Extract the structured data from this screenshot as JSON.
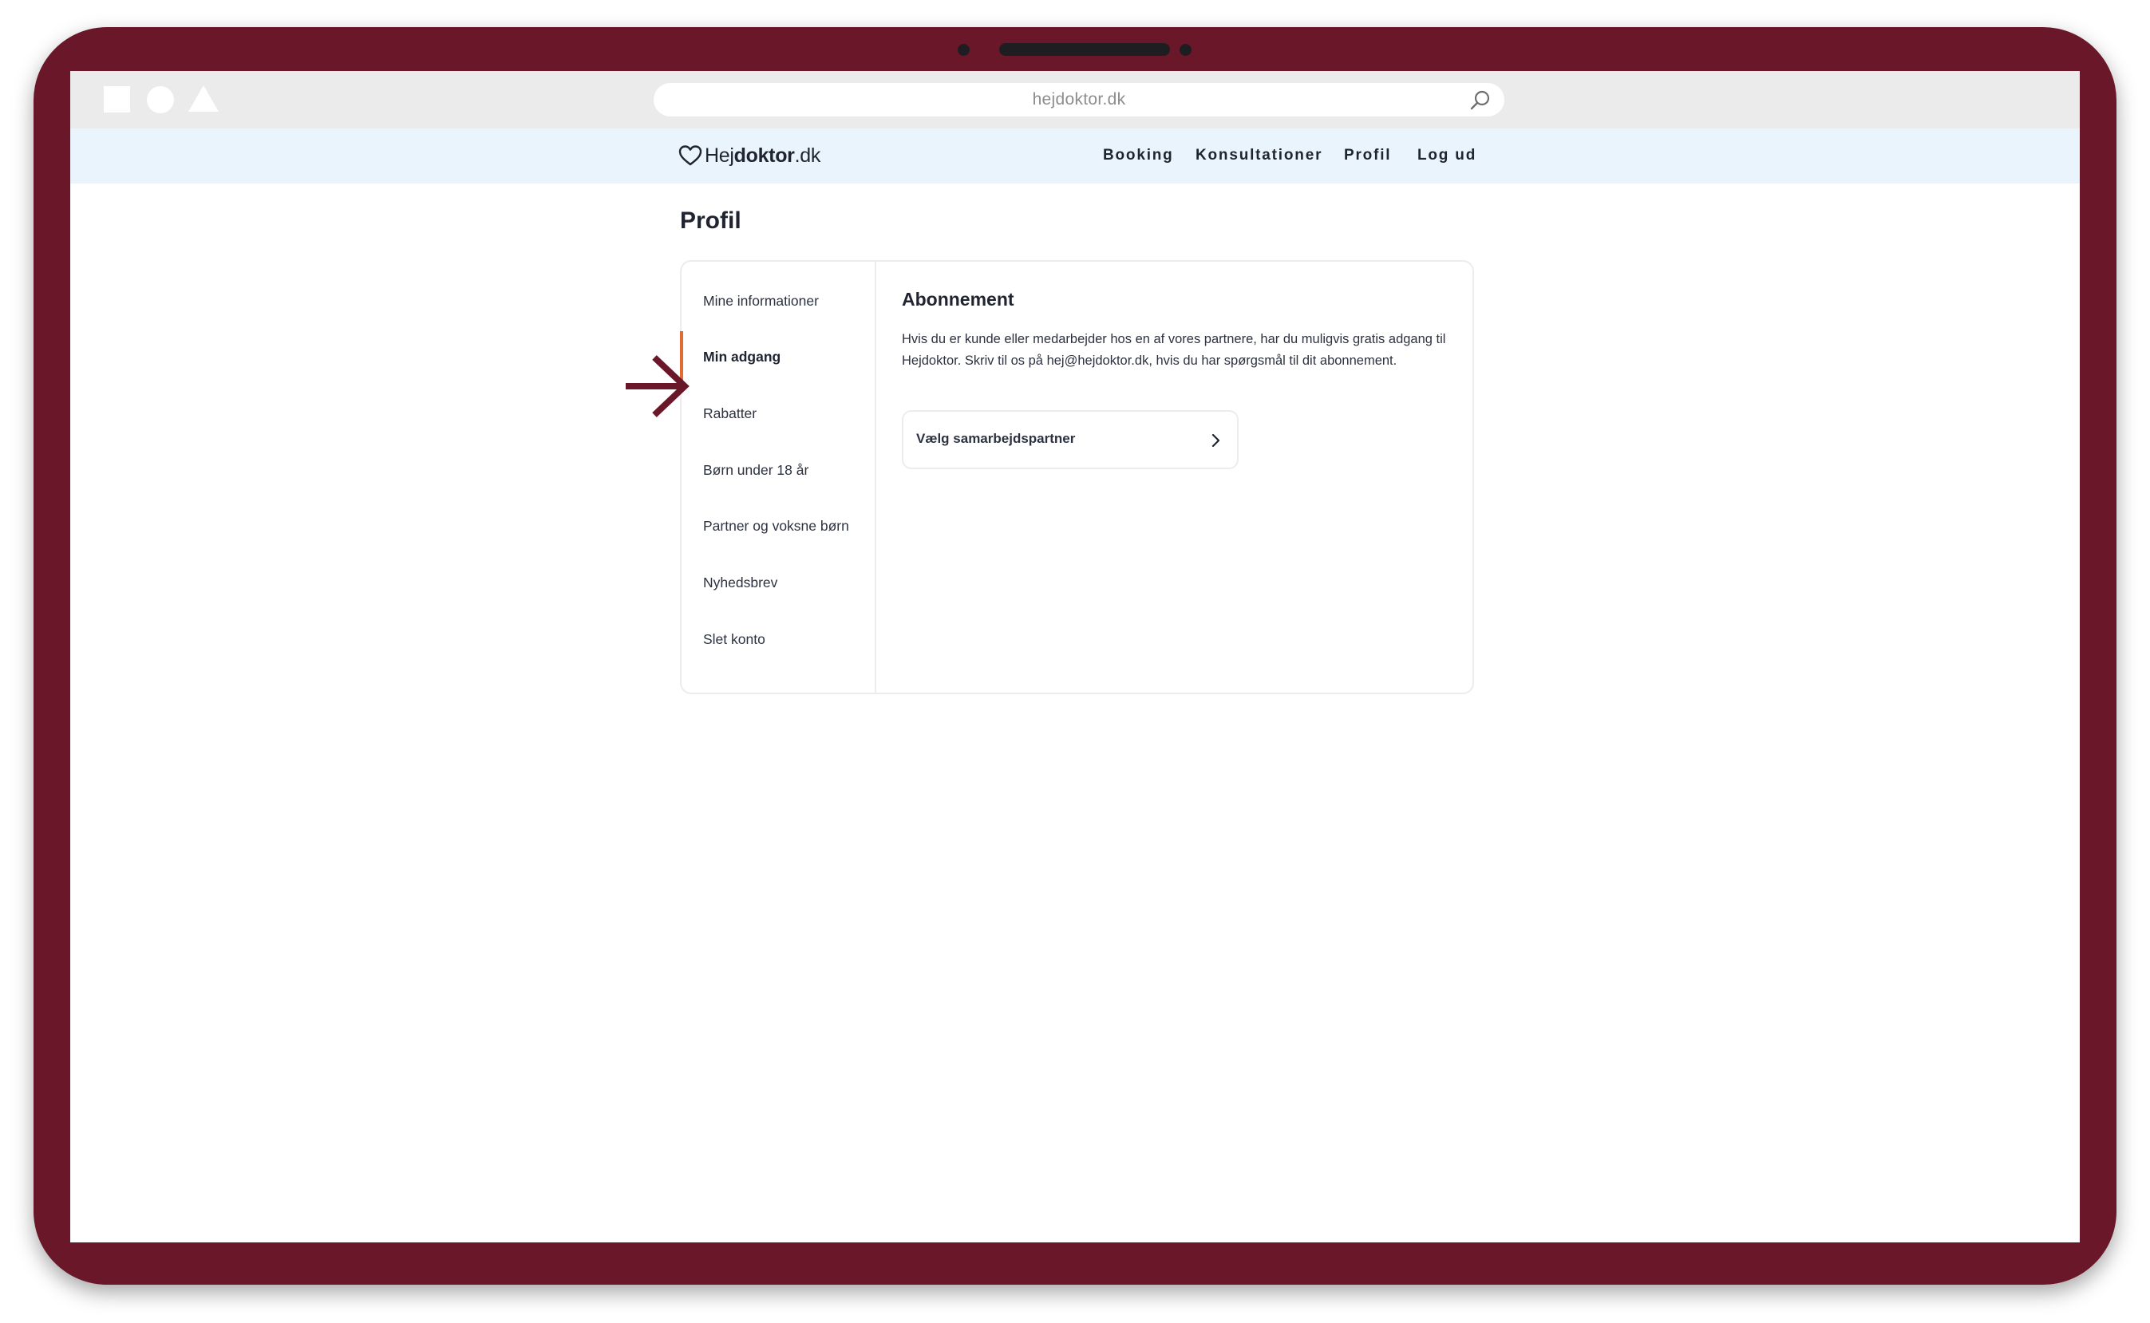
{
  "browser": {
    "url": "hejdoktor.dk"
  },
  "header": {
    "logo": {
      "light": "Hej",
      "bold": "doktor",
      "suffix": ".dk"
    },
    "nav": [
      "Booking",
      "Konsultationer",
      "Profil",
      "Log ud"
    ]
  },
  "page": {
    "title": "Profil"
  },
  "sidebar": {
    "active_index": 1,
    "items": [
      {
        "label": "Mine informationer"
      },
      {
        "label": "Min adgang"
      },
      {
        "label": "Rabatter"
      },
      {
        "label": "Børn under 18 år"
      },
      {
        "label": "Partner og voksne børn"
      },
      {
        "label": "Nyhedsbrev"
      },
      {
        "label": "Slet konto"
      }
    ]
  },
  "content": {
    "title": "Abonnement",
    "body": "Hvis du er kunde eller medarbejder hos en af vores partnere, har du muligvis gratis adgang til Hejdoktor. Skriv til os på hej@hejdoktor.dk, hvis du har spørgsmål til dit abonnement.",
    "partner_button_label": "Vælg samarbejdspartner"
  },
  "colors": {
    "device_frame": "#6a1729",
    "header_bg": "#e9f4fc",
    "active_indicator": "#e26a34",
    "text_dark": "#1f2430"
  },
  "icons": [
    "search-icon",
    "heart-logo-icon",
    "chevron-right-icon",
    "arrow-right-icon"
  ]
}
